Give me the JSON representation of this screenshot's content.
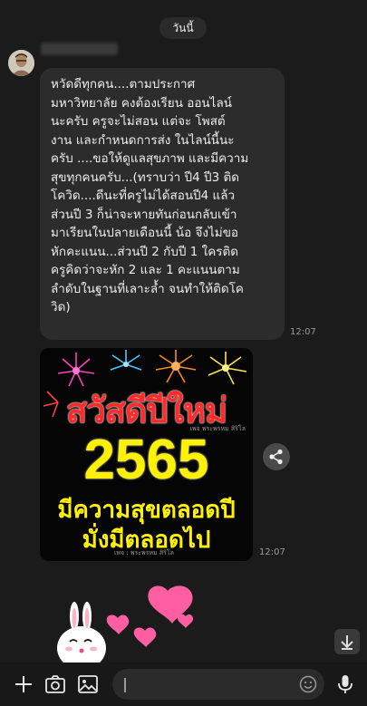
{
  "chat": {
    "date_label": "วันนี้",
    "message_text": "หวัดดีทุกคน....ตามประกาศ\nมหาวิทยาลัย คงต้องเรียน ออนไลน์\nนะครับ ครูจะไม่สอน แต่จะ โพสต์\nงาน และกำหนดการส่ง ในไลน์นี้นะ\nครับ ....ขอให้ดูแลสุขภาพ และมีความ\nสุขทุกคนครับ...(ทราบว่า ปี4 ปี3 ติด\nโควิด....ดีนะที่ครูไม่ได้สอนปี4 แล้ว\nส่วนปี 3 ก็น่าจะหายทันก่อนกลับเข้า\nมาเรียนในปลายเดือนนี้ น้อ จึงไม่ขอ\nหักคะแนน...ส่วนปี 2 กับปี 1 ใครติด\nครูคิดว่าจะหัก 2 และ 1 คะแนนตาม\nลำดับในฐานที่เลาะล้ำ จนทำให้ติดโค\nวิด)",
    "message_time": "12:07",
    "image_time": "12:07"
  },
  "greeting_image": {
    "title": "สวัสดีปีใหม่",
    "year": "2565",
    "line1": "มีความสุขตลอดปี",
    "line2": "มั่งมีตลอดไป",
    "credit_top": "เพจ พระพรหม สิริโล",
    "credit_bottom": "เพจ : พระพรหม สิริโล"
  },
  "input": {
    "placeholder": ""
  },
  "colors": {
    "background": "#1b1b1b",
    "bubble": "#2c2c2c",
    "title_red": "#ff2a2a",
    "year_yellow": "#fff200"
  },
  "icons": [
    "plus-icon",
    "camera-icon",
    "image-icon",
    "emoji-icon",
    "microphone-icon",
    "share-icon",
    "arrow-down-icon"
  ]
}
